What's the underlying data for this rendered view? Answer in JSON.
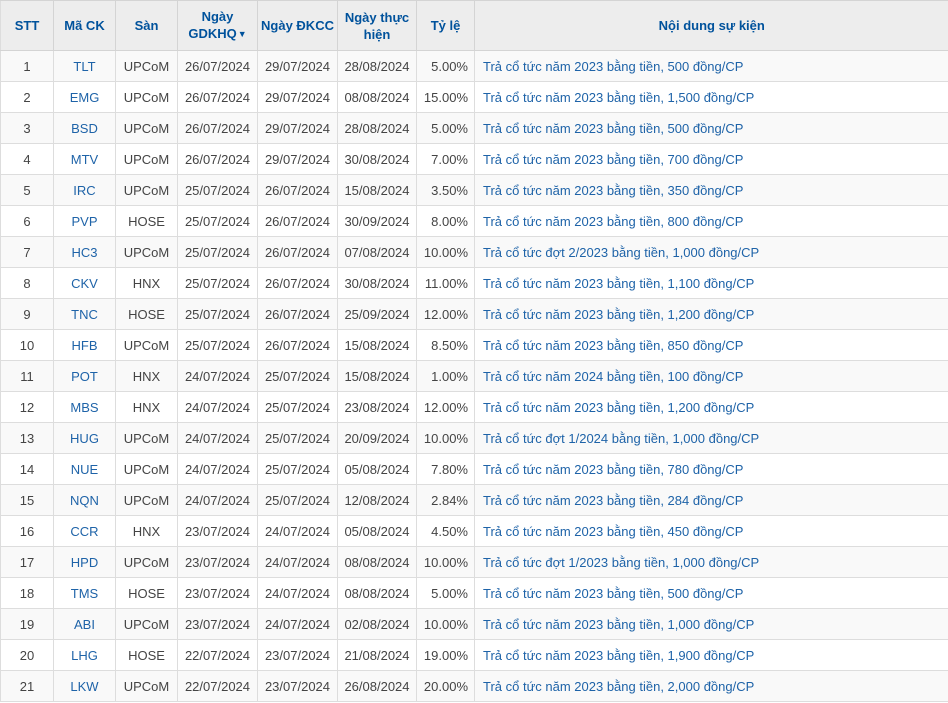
{
  "table": {
    "sort_icon": "▼",
    "columns": [
      {
        "label": "STT"
      },
      {
        "label": "Mã CK"
      },
      {
        "label": "Sàn"
      },
      {
        "label": "Ngày GDKHQ",
        "sorted": "desc"
      },
      {
        "label": "Ngày ĐKCC"
      },
      {
        "label": "Ngày thực hiện"
      },
      {
        "label": "Tỷ lệ"
      },
      {
        "label": "Nội dung sự kiện"
      }
    ],
    "rows": [
      {
        "stt": "1",
        "code": "TLT",
        "exchange": "UPCoM",
        "ex_date": "26/07/2024",
        "record_date": "29/07/2024",
        "exec_date": "28/08/2024",
        "ratio": "5.00%",
        "content": "Trả cổ tức năm 2023 bằng tiền, 500 đồng/CP"
      },
      {
        "stt": "2",
        "code": "EMG",
        "exchange": "UPCoM",
        "ex_date": "26/07/2024",
        "record_date": "29/07/2024",
        "exec_date": "08/08/2024",
        "ratio": "15.00%",
        "content": "Trả cổ tức năm 2023 bằng tiền, 1,500 đồng/CP"
      },
      {
        "stt": "3",
        "code": "BSD",
        "exchange": "UPCoM",
        "ex_date": "26/07/2024",
        "record_date": "29/07/2024",
        "exec_date": "28/08/2024",
        "ratio": "5.00%",
        "content": "Trả cổ tức năm 2023 bằng tiền, 500 đồng/CP"
      },
      {
        "stt": "4",
        "code": "MTV",
        "exchange": "UPCoM",
        "ex_date": "26/07/2024",
        "record_date": "29/07/2024",
        "exec_date": "30/08/2024",
        "ratio": "7.00%",
        "content": "Trả cổ tức năm 2023 bằng tiền, 700 đồng/CP"
      },
      {
        "stt": "5",
        "code": "IRC",
        "exchange": "UPCoM",
        "ex_date": "25/07/2024",
        "record_date": "26/07/2024",
        "exec_date": "15/08/2024",
        "ratio": "3.50%",
        "content": "Trả cổ tức năm 2023 bằng tiền, 350 đồng/CP"
      },
      {
        "stt": "6",
        "code": "PVP",
        "exchange": "HOSE",
        "ex_date": "25/07/2024",
        "record_date": "26/07/2024",
        "exec_date": "30/09/2024",
        "ratio": "8.00%",
        "content": "Trả cổ tức năm 2023 bằng tiền, 800 đồng/CP"
      },
      {
        "stt": "7",
        "code": "HC3",
        "exchange": "UPCoM",
        "ex_date": "25/07/2024",
        "record_date": "26/07/2024",
        "exec_date": "07/08/2024",
        "ratio": "10.00%",
        "content": "Trả cổ tức đợt 2/2023 bằng tiền, 1,000 đồng/CP"
      },
      {
        "stt": "8",
        "code": "CKV",
        "exchange": "HNX",
        "ex_date": "25/07/2024",
        "record_date": "26/07/2024",
        "exec_date": "30/08/2024",
        "ratio": "11.00%",
        "content": "Trả cổ tức năm 2023 bằng tiền, 1,100 đồng/CP"
      },
      {
        "stt": "9",
        "code": "TNC",
        "exchange": "HOSE",
        "ex_date": "25/07/2024",
        "record_date": "26/07/2024",
        "exec_date": "25/09/2024",
        "ratio": "12.00%",
        "content": "Trả cổ tức năm 2023 bằng tiền, 1,200 đồng/CP"
      },
      {
        "stt": "10",
        "code": "HFB",
        "exchange": "UPCoM",
        "ex_date": "25/07/2024",
        "record_date": "26/07/2024",
        "exec_date": "15/08/2024",
        "ratio": "8.50%",
        "content": "Trả cổ tức năm 2023 bằng tiền, 850 đồng/CP"
      },
      {
        "stt": "11",
        "code": "POT",
        "exchange": "HNX",
        "ex_date": "24/07/2024",
        "record_date": "25/07/2024",
        "exec_date": "15/08/2024",
        "ratio": "1.00%",
        "content": "Trả cổ tức năm 2024 bằng tiền, 100 đồng/CP"
      },
      {
        "stt": "12",
        "code": "MBS",
        "exchange": "HNX",
        "ex_date": "24/07/2024",
        "record_date": "25/07/2024",
        "exec_date": "23/08/2024",
        "ratio": "12.00%",
        "content": "Trả cổ tức năm 2023 bằng tiền, 1,200 đồng/CP"
      },
      {
        "stt": "13",
        "code": "HUG",
        "exchange": "UPCoM",
        "ex_date": "24/07/2024",
        "record_date": "25/07/2024",
        "exec_date": "20/09/2024",
        "ratio": "10.00%",
        "content": "Trả cổ tức đợt 1/2024 bằng tiền, 1,000 đồng/CP"
      },
      {
        "stt": "14",
        "code": "NUE",
        "exchange": "UPCoM",
        "ex_date": "24/07/2024",
        "record_date": "25/07/2024",
        "exec_date": "05/08/2024",
        "ratio": "7.80%",
        "content": "Trả cổ tức năm 2023 bằng tiền, 780 đồng/CP"
      },
      {
        "stt": "15",
        "code": "NQN",
        "exchange": "UPCoM",
        "ex_date": "24/07/2024",
        "record_date": "25/07/2024",
        "exec_date": "12/08/2024",
        "ratio": "2.84%",
        "content": "Trả cổ tức năm 2023 bằng tiền, 284 đồng/CP"
      },
      {
        "stt": "16",
        "code": "CCR",
        "exchange": "HNX",
        "ex_date": "23/07/2024",
        "record_date": "24/07/2024",
        "exec_date": "05/08/2024",
        "ratio": "4.50%",
        "content": "Trả cổ tức năm 2023 bằng tiền, 450 đồng/CP"
      },
      {
        "stt": "17",
        "code": "HPD",
        "exchange": "UPCoM",
        "ex_date": "23/07/2024",
        "record_date": "24/07/2024",
        "exec_date": "08/08/2024",
        "ratio": "10.00%",
        "content": "Trả cổ tức đợt 1/2023 bằng tiền, 1,000 đồng/CP"
      },
      {
        "stt": "18",
        "code": "TMS",
        "exchange": "HOSE",
        "ex_date": "23/07/2024",
        "record_date": "24/07/2024",
        "exec_date": "08/08/2024",
        "ratio": "5.00%",
        "content": "Trả cổ tức năm 2023 bằng tiền, 500 đồng/CP"
      },
      {
        "stt": "19",
        "code": "ABI",
        "exchange": "UPCoM",
        "ex_date": "23/07/2024",
        "record_date": "24/07/2024",
        "exec_date": "02/08/2024",
        "ratio": "10.00%",
        "content": "Trả cổ tức năm 2023 bằng tiền, 1,000 đồng/CP"
      },
      {
        "stt": "20",
        "code": "LHG",
        "exchange": "HOSE",
        "ex_date": "22/07/2024",
        "record_date": "23/07/2024",
        "exec_date": "21/08/2024",
        "ratio": "19.00%",
        "content": "Trả cổ tức năm 2023 bằng tiền, 1,900 đồng/CP"
      },
      {
        "stt": "21",
        "code": "LKW",
        "exchange": "UPCoM",
        "ex_date": "22/07/2024",
        "record_date": "23/07/2024",
        "exec_date": "26/08/2024",
        "ratio": "20.00%",
        "content": "Trả cổ tức năm 2023 bằng tiền, 2,000 đồng/CP"
      }
    ]
  },
  "colors": {
    "header_bg": "#ededed",
    "header_text": "#00529c",
    "link": "#1e63a8",
    "body_text": "#444444",
    "border": "#dddddd",
    "row_odd_bg": "#f9f9f9",
    "row_even_bg": "#ffffff"
  }
}
